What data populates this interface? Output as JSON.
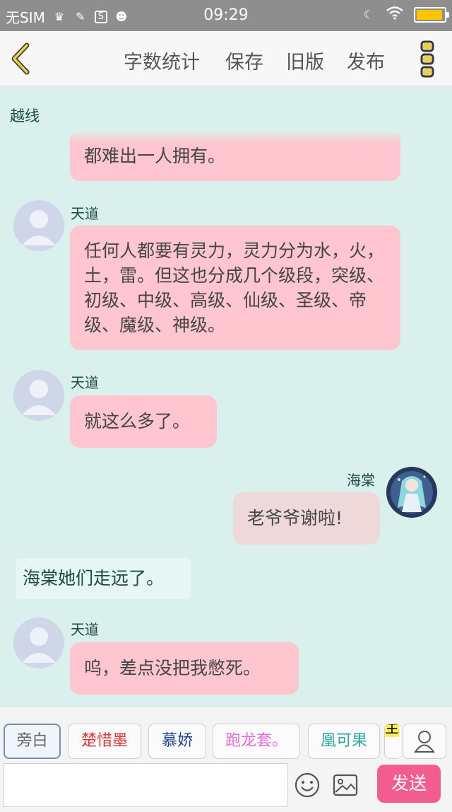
{
  "status_bar": {
    "carrier": "无SIM",
    "time": "09:29"
  },
  "header": {
    "menu": [
      "字数统计",
      "保存",
      "旧版",
      "发布"
    ]
  },
  "chat": {
    "chapter_label": "越线",
    "messages": [
      {
        "speaker": "",
        "side": "left",
        "text": "都难出一人拥有。"
      },
      {
        "speaker": "天道",
        "side": "left",
        "text": "任何人都要有灵力，灵力分为水，火，土，雷。但这也分成几个级段，突级、初级、中级、高级、仙级、圣级、帝级、魔级、神级。"
      },
      {
        "speaker": "天道",
        "side": "left",
        "text": "就这么多了。"
      },
      {
        "speaker": "海棠",
        "side": "right",
        "text": "老爷爷谢啦!"
      },
      {
        "speaker": "",
        "side": "narration",
        "text": "海棠她们走远了。"
      },
      {
        "speaker": "天道",
        "side": "left",
        "text": "呜，差点没把我憋死。"
      }
    ]
  },
  "characters": [
    {
      "name": "旁白",
      "color": "#666666"
    },
    {
      "name": "楚惜墨",
      "color": "#d23c3c"
    },
    {
      "name": "慕娇",
      "color": "#1f3f8a"
    },
    {
      "name": "跑龙套。",
      "color": "#e06ed8"
    },
    {
      "name": "凰可果",
      "color": "#2aa7a0"
    },
    {
      "name": "主",
      "color": "#333333"
    }
  ],
  "composer": {
    "placeholder": "",
    "send_label": "发送"
  },
  "colors": {
    "accent": "#f25c8e",
    "bubble_pink": "#ffc6d0",
    "background": "#daf0ec",
    "menu_icon": "#c9b84a"
  }
}
